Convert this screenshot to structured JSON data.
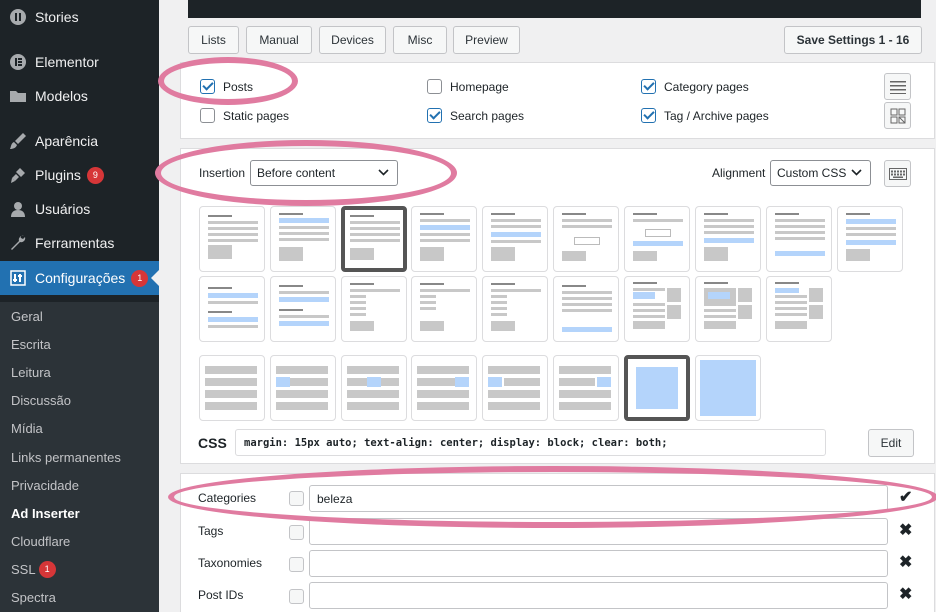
{
  "sidebar": {
    "items": [
      {
        "label": "Stories",
        "icon": "stories-icon"
      },
      {
        "label": "Elementor",
        "icon": "elementor-icon"
      },
      {
        "label": "Modelos",
        "icon": "folder-icon"
      },
      {
        "label": "Aparência",
        "icon": "brush-icon"
      },
      {
        "label": "Plugins",
        "icon": "plug-icon",
        "badge": "9"
      },
      {
        "label": "Usuários",
        "icon": "user-icon"
      },
      {
        "label": "Ferramentas",
        "icon": "wrench-icon"
      },
      {
        "label": "Configurações",
        "icon": "settings-icon",
        "badge": "1",
        "current": true
      }
    ],
    "submenu": [
      {
        "label": "Geral"
      },
      {
        "label": "Escrita"
      },
      {
        "label": "Leitura"
      },
      {
        "label": "Discussão"
      },
      {
        "label": "Mídia"
      },
      {
        "label": "Links permanentes"
      },
      {
        "label": "Privacidade"
      },
      {
        "label": "Ad Inserter",
        "current": true
      },
      {
        "label": "Cloudflare"
      },
      {
        "label": "SSL",
        "badge": "1"
      },
      {
        "label": "Spectra"
      }
    ]
  },
  "toolbar": {
    "buttons": [
      "Lists",
      "Manual",
      "Devices",
      "Misc",
      "Preview"
    ],
    "save_label": "Save Settings 1 - 16"
  },
  "page_types": [
    {
      "label": "Posts",
      "checked": true
    },
    {
      "label": "Homepage",
      "checked": false
    },
    {
      "label": "Category pages",
      "checked": true
    },
    {
      "label": "Static pages",
      "checked": false
    },
    {
      "label": "Search pages",
      "checked": true
    },
    {
      "label": "Tag / Archive pages",
      "checked": true
    }
  ],
  "insertion": {
    "label": "Insertion",
    "value": "Before content"
  },
  "alignment": {
    "label": "Alignment",
    "value": "Custom CSS"
  },
  "css": {
    "label": "CSS",
    "value": "margin: 15px auto; text-align: center; display: block; clear: both;",
    "edit_label": "Edit"
  },
  "lists": [
    {
      "label": "Categories",
      "value": "beleza",
      "mark": "✔"
    },
    {
      "label": "Tags",
      "value": "",
      "mark": "✖"
    },
    {
      "label": "Taxonomies",
      "value": "",
      "mark": "✖"
    },
    {
      "label": "Post IDs",
      "value": "",
      "mark": "✖"
    }
  ],
  "colors": {
    "accent": "#2271b1",
    "highlight": "#e07ba0",
    "sidebar": "#1d2327",
    "badge": "#d63638"
  }
}
